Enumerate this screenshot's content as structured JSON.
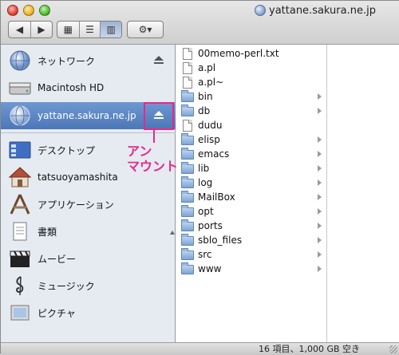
{
  "window": {
    "title": "yattane.sakura.ne.jp"
  },
  "toolbar": {
    "back_glyph": "◀",
    "forward_glyph": "▶",
    "view_icon_glyph": "▦",
    "view_list_glyph": "☰",
    "view_column_glyph": "▥",
    "action_glyph": "⚙▾"
  },
  "sidebar": {
    "items": [
      {
        "label": "ネットワーク",
        "icon": "network-globe-icon"
      },
      {
        "label": "Macintosh HD",
        "icon": "hard-drive-icon"
      },
      {
        "label": "yattane.sakura.ne.jp",
        "icon": "server-globe-icon"
      },
      {
        "label": "デスクトップ",
        "icon": "desktop-icon"
      },
      {
        "label": "tatsuoyamashita",
        "icon": "home-icon"
      },
      {
        "label": "アプリケーション",
        "icon": "applications-icon"
      },
      {
        "label": "書類",
        "icon": "documents-icon"
      },
      {
        "label": "ムービー",
        "icon": "movies-clapper-icon"
      },
      {
        "label": "ミュージック",
        "icon": "music-clef-icon"
      },
      {
        "label": "ピクチャ",
        "icon": "pictures-icon"
      }
    ],
    "selected_index": 2
  },
  "annotation": {
    "line1": "アン",
    "line2": "マウント",
    "color": "#e8298a"
  },
  "files": [
    {
      "name": "00memo-perl.txt",
      "type": "file"
    },
    {
      "name": "a.pl",
      "type": "file"
    },
    {
      "name": "a.pl~",
      "type": "file"
    },
    {
      "name": "bin",
      "type": "folder"
    },
    {
      "name": "db",
      "type": "folder"
    },
    {
      "name": "dudu",
      "type": "file"
    },
    {
      "name": "elisp",
      "type": "folder"
    },
    {
      "name": "emacs",
      "type": "folder"
    },
    {
      "name": "lib",
      "type": "folder"
    },
    {
      "name": "log",
      "type": "folder"
    },
    {
      "name": "MailBox",
      "type": "folder"
    },
    {
      "name": "opt",
      "type": "folder"
    },
    {
      "name": "ports",
      "type": "folder"
    },
    {
      "name": "sblo_files",
      "type": "folder"
    },
    {
      "name": "src",
      "type": "folder"
    },
    {
      "name": "www",
      "type": "folder"
    }
  ],
  "status": {
    "text": "16 項目、1,000 GB 空き"
  },
  "colors": {
    "selection": "#4c77b7",
    "sidebar_bg": "#e6ebf2",
    "annotation": "#e8298a"
  }
}
